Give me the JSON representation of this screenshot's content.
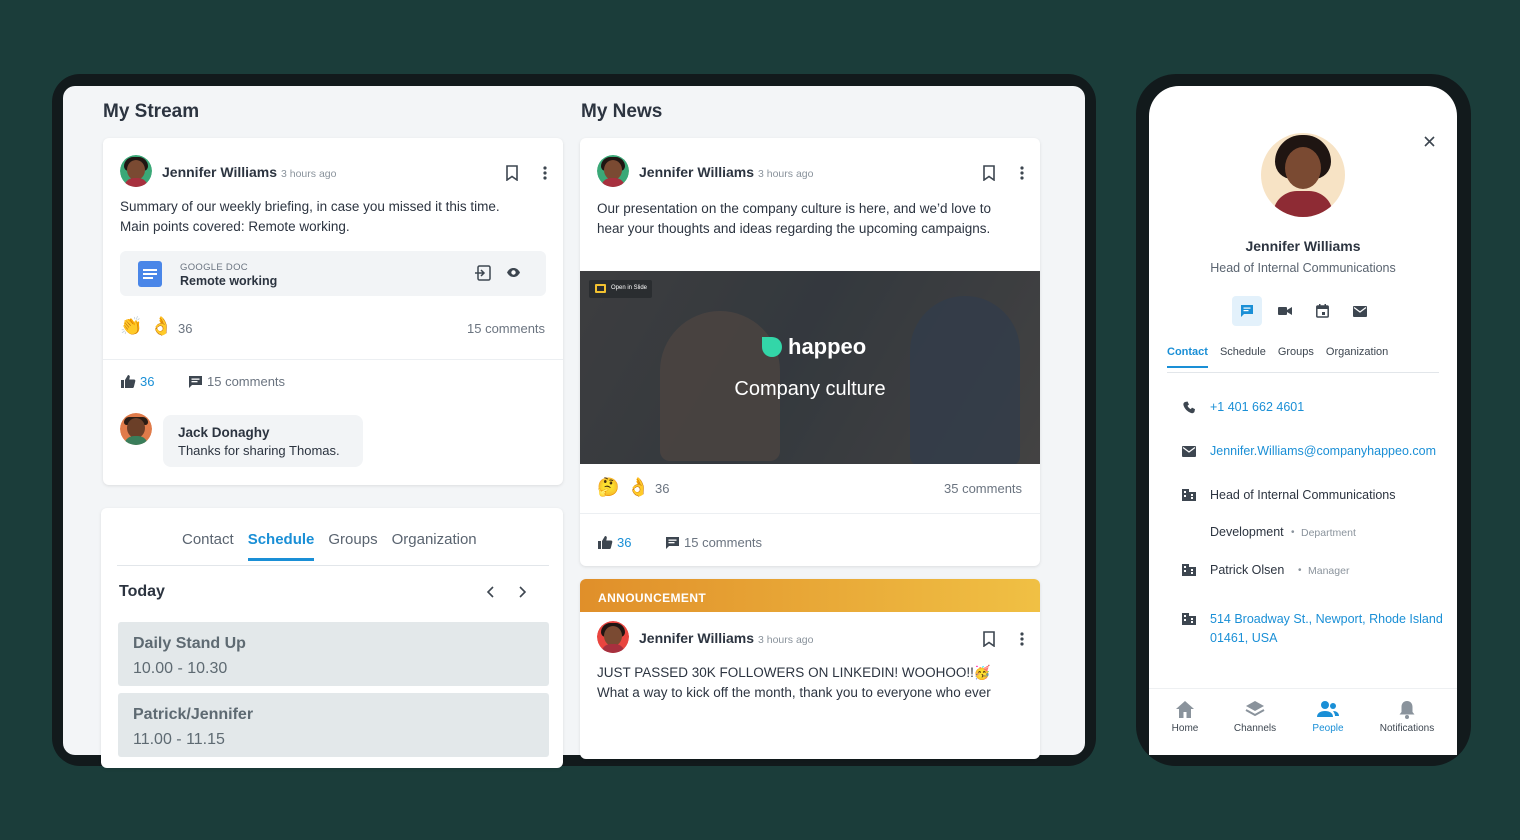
{
  "stream": {
    "title": "My Stream",
    "post": {
      "author": "Jennifer Williams",
      "time": "3 hours ago",
      "line1": "Summary of our weekly briefing, in case you missed it this time.",
      "line2": "Main points covered: Remote working.",
      "doc": {
        "type": "GOOGLE DOC",
        "name": "Remote working"
      },
      "reaction_count": "36",
      "comments_summary": "15 comments",
      "like_count": "36",
      "comments_action": "15 comments",
      "reply": {
        "author": "Jack Donaghy",
        "text": "Thanks for sharing Thomas."
      }
    }
  },
  "profile_tabs": {
    "tabs": [
      "Contact",
      "Schedule",
      "Groups",
      "Organization"
    ],
    "active": "Schedule",
    "day_label": "Today",
    "events": [
      {
        "title": "Daily Stand Up",
        "time": "10.00 - 10.30"
      },
      {
        "title": "Patrick/Jennifer",
        "time": "11.00 - 11.15"
      }
    ]
  },
  "news": {
    "title": "My News",
    "post": {
      "author": "Jennifer Williams",
      "time": "3 hours ago",
      "line1": "Our presentation on the company culture is here, and we’d love to",
      "line2": "hear your thoughts and ideas regarding the upcoming campaigns.",
      "open_in_slide": "Open in Slide",
      "brand": "happeo",
      "hero_caption": "Company culture",
      "reaction_count": "36",
      "comments_summary": "35 comments",
      "like_count": "36",
      "comments_action": "15 comments"
    },
    "announcement": {
      "label": "ANNOUNCEMENT",
      "author": "Jennifer Williams",
      "time": "3 hours ago",
      "line1": "JUST PASSED 30K FOLLOWERS ON LINKEDIN! WOOHOO!!🥳",
      "line2": "What a way to kick off the month, thank you to everyone who ever"
    }
  },
  "phone": {
    "name": "Jennifer Williams",
    "role": "Head of Internal Communications",
    "tabs": [
      "Contact",
      "Schedule",
      "Groups",
      "Organization"
    ],
    "active_tab": "Contact",
    "phone": "+1 401 662 4601",
    "email": "Jennifer.Williams@companyhappeo.com",
    "title": "Head of Internal Communications",
    "department": "Development",
    "department_label": "Department",
    "manager": "Patrick Olsen",
    "manager_label": "Manager",
    "address_line1": "514 Broadway St., Newport, Rhode Island",
    "address_line2": "01461, USA",
    "nav": [
      {
        "label": "Home",
        "icon": "home-icon"
      },
      {
        "label": "Channels",
        "icon": "layers-icon"
      },
      {
        "label": "People",
        "icon": "people-icon"
      },
      {
        "label": "Notifications",
        "icon": "bell-icon"
      }
    ],
    "active_nav": "People"
  },
  "colors": {
    "background": "#1b3d3a",
    "accent": "#1a8fd6",
    "announcement": "#e08f2a"
  }
}
